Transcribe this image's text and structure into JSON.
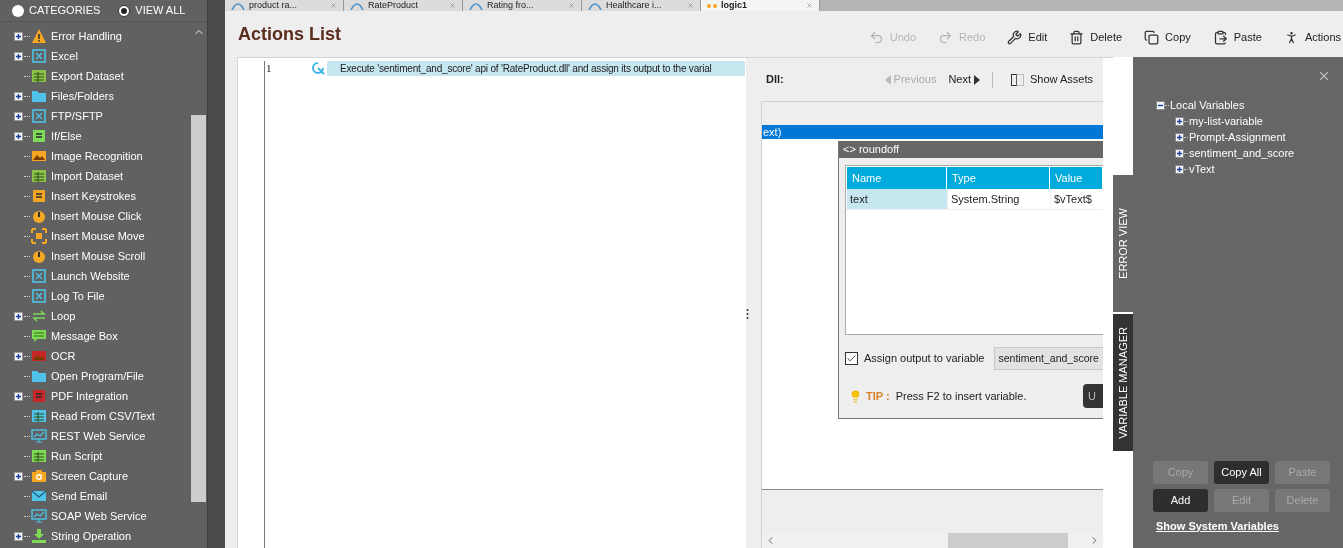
{
  "sidebar": {
    "view_options": [
      {
        "label": "CATEGORIES",
        "selected": false
      },
      {
        "label": "VIEW ALL",
        "selected": true
      }
    ],
    "items": [
      {
        "label": "Error Handling",
        "expandable": true
      },
      {
        "label": "Excel",
        "expandable": true
      },
      {
        "label": "Export Dataset",
        "expandable": false
      },
      {
        "label": "Files/Folders",
        "expandable": true
      },
      {
        "label": "FTP/SFTP",
        "expandable": true
      },
      {
        "label": "If/Else",
        "expandable": true
      },
      {
        "label": "Image Recognition",
        "expandable": false
      },
      {
        "label": "Import Dataset",
        "expandable": false
      },
      {
        "label": "Insert Keystrokes",
        "expandable": false
      },
      {
        "label": "Insert Mouse Click",
        "expandable": false
      },
      {
        "label": "Insert Mouse Move",
        "expandable": false
      },
      {
        "label": "Insert Mouse Scroll",
        "expandable": false
      },
      {
        "label": "Launch Website",
        "expandable": false
      },
      {
        "label": "Log To File",
        "expandable": false
      },
      {
        "label": "Loop",
        "expandable": true
      },
      {
        "label": "Message Box",
        "expandable": false
      },
      {
        "label": "OCR",
        "expandable": true
      },
      {
        "label": "Open Program/File",
        "expandable": false
      },
      {
        "label": "PDF Integration",
        "expandable": true
      },
      {
        "label": "Read From CSV/Text",
        "expandable": false
      },
      {
        "label": "REST Web Service",
        "expandable": false
      },
      {
        "label": "Run Script",
        "expandable": false
      },
      {
        "label": "Screen Capture",
        "expandable": true
      },
      {
        "label": "Send Email",
        "expandable": false
      },
      {
        "label": "SOAP Web Service",
        "expandable": false
      },
      {
        "label": "String Operation",
        "expandable": true
      }
    ]
  },
  "tabs": [
    {
      "label": "product ra...",
      "selected": false
    },
    {
      "label": "RateProduct",
      "selected": false
    },
    {
      "label": "Rating fro...",
      "selected": false
    },
    {
      "label": "Healthcare i...",
      "selected": false
    },
    {
      "label": "logic1",
      "selected": true
    }
  ],
  "title": "Actions List",
  "toolbar": [
    {
      "label": "Undo",
      "disabled": true
    },
    {
      "label": "Redo",
      "disabled": true
    },
    {
      "label": "Edit",
      "disabled": false
    },
    {
      "label": "Delete",
      "disabled": false
    },
    {
      "label": "Copy",
      "disabled": false
    },
    {
      "label": "Paste",
      "disabled": false
    },
    {
      "label": "Actions",
      "disabled": false
    }
  ],
  "editor": {
    "lines": [
      {
        "number": "1",
        "text": "Execute 'sentiment_and_score' api of 'RateProduct.dll' and assign its output to the varial",
        "selected": true
      }
    ]
  },
  "dll_panel": {
    "label": "Dll:",
    "nav": [
      {
        "label": "Previous",
        "disabled": true
      },
      {
        "label": "Next",
        "disabled": false
      }
    ],
    "show_assets": "Show Assets",
    "selected_row": "ext)",
    "dialog": {
      "title": "<> roundoff",
      "columns": [
        "Name",
        "Type",
        "Value"
      ],
      "rows": [
        {
          "name": "text",
          "type": "System.String",
          "value": "$vText$",
          "selected": true
        }
      ],
      "assign_output": {
        "label": "Assign output to variable",
        "checked": true
      },
      "output_variable": "sentiment_and_score",
      "tip_label": "TIP :",
      "tip": "Press F2 to insert variable.",
      "button": "U"
    }
  },
  "side_tabs": [
    {
      "label": "ERROR VIEW",
      "selected": false
    },
    {
      "label": "VARIABLE MANAGER",
      "selected": true
    }
  ],
  "variables": {
    "tree": [
      {
        "label": "Local Variables",
        "expanded": true,
        "children": [
          {
            "label": "my-list-variable",
            "expanded": false
          },
          {
            "label": "Prompt-Assignment",
            "expanded": false
          },
          {
            "label": "sentiment_and_score",
            "expanded": false
          },
          {
            "label": "vText",
            "expanded": false
          }
        ]
      }
    ],
    "buttons": [
      {
        "label": "Copy",
        "disabled": true
      },
      {
        "label": "Copy All",
        "disabled": false
      },
      {
        "label": "Paste",
        "disabled": true
      },
      {
        "label": "Add",
        "disabled": false
      },
      {
        "label": "Edit",
        "disabled": true
      },
      {
        "label": "Delete",
        "disabled": true
      }
    ],
    "link": "Show System Variables"
  }
}
